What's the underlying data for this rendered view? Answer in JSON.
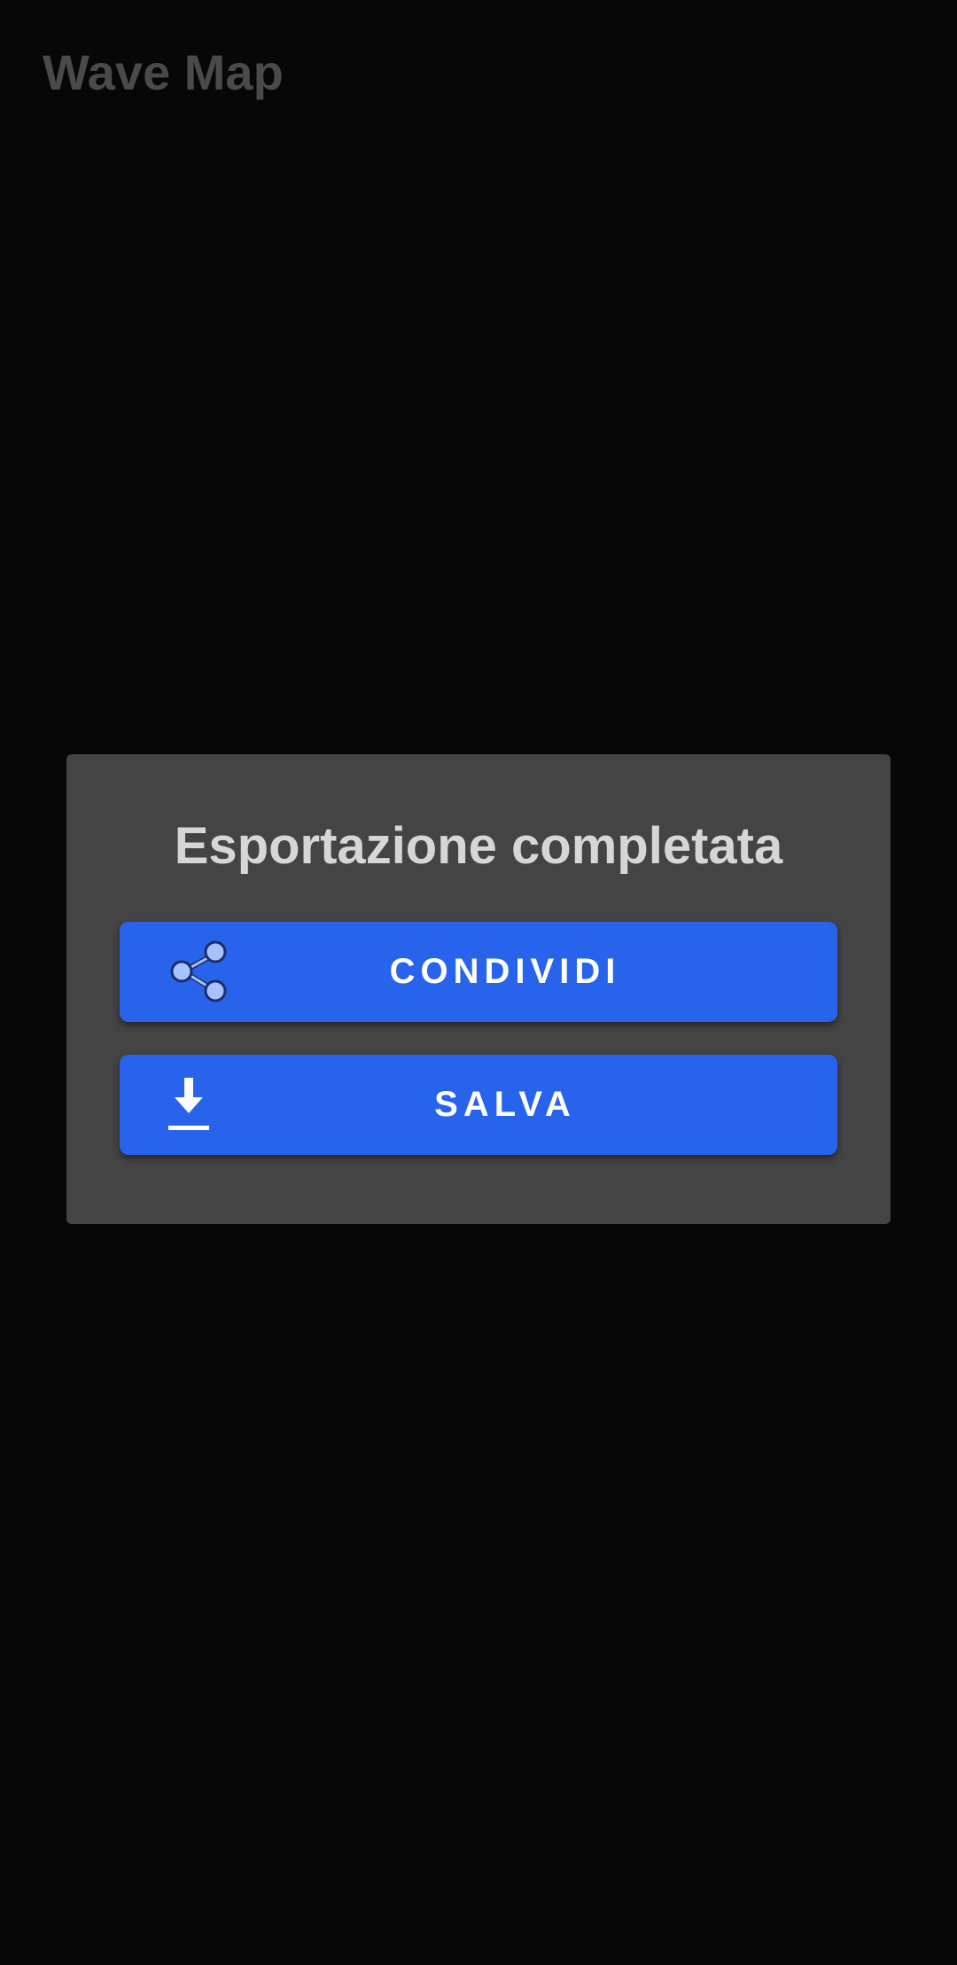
{
  "app": {
    "title": "Wave Map"
  },
  "dialog": {
    "title": "Esportazione completata",
    "buttons": {
      "share": {
        "label": "CONDIVIDI",
        "icon": "share-icon"
      },
      "save": {
        "label": "SALVA",
        "icon": "download-icon"
      }
    }
  },
  "colors": {
    "background": "#070707",
    "dialog_background": "#444444",
    "button_accent": "#2764eb",
    "title_text": "#d6d6d6",
    "app_title_text": "#4a4a4a"
  }
}
